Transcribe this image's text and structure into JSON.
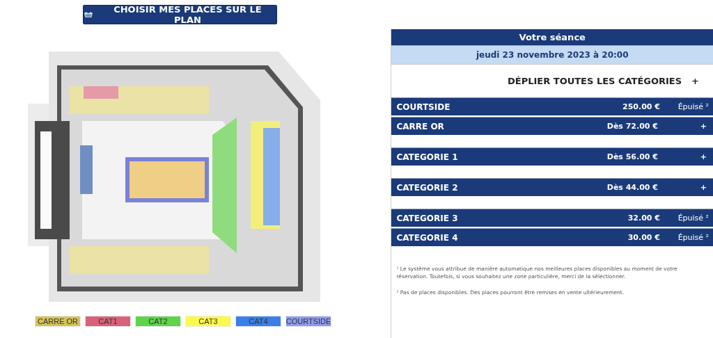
{
  "plan_button": {
    "label": "CHOISIR MES PLACES SUR LE PLAN"
  },
  "legend": [
    {
      "label": "CARRE OR",
      "color": "#d4c35a"
    },
    {
      "label": "CAT1",
      "color": "#d9627a"
    },
    {
      "label": "CAT2",
      "color": "#5fd44a"
    },
    {
      "label": "CAT3",
      "color": "#fdf84c"
    },
    {
      "label": "CAT4",
      "color": "#3b7fe8"
    },
    {
      "label": "COURTSIDE",
      "color": "#8f9cf0"
    }
  ],
  "session": {
    "title": "Votre séance",
    "date": "jeudi 23 novembre 2023 à 20:00"
  },
  "expand_all": {
    "label": "DÉPLIER TOUTES LES CATÉGORIES",
    "icon": "+"
  },
  "category_groups": [
    {
      "categories": [
        {
          "name": "COURTSIDE",
          "price": "250.00 €",
          "kind": "sold_out",
          "status": "Épuisé ²"
        },
        {
          "name": "CARRE OR",
          "price": "Dès 72.00 €",
          "kind": "expandable",
          "status": "+"
        }
      ]
    },
    {
      "categories": [
        {
          "name": "CATEGORIE 1",
          "price": "Dès 56.00 €",
          "kind": "expandable",
          "status": "+"
        }
      ]
    },
    {
      "categories": [
        {
          "name": "CATEGORIE 2",
          "price": "Dès 44.00 €",
          "kind": "expandable",
          "status": "+"
        }
      ]
    },
    {
      "categories": [
        {
          "name": "CATEGORIE 3",
          "price": "32.00 €",
          "kind": "sold_out",
          "status": "Épuisé ²"
        },
        {
          "name": "CATEGORIE 4",
          "price": "30.00 €",
          "kind": "sold_out",
          "status": "Épuisé ²"
        }
      ]
    }
  ],
  "notes": [
    "¹ Le système vous attribue de manière automatique nos meilleures places disponibles au moment de votre réservation. Toutefois, si vous souhaitez une zone particulière, merci de la sélectionner.",
    "² Pas de places disponibles. Des places pourront être remises en vente ultérieurement."
  ]
}
